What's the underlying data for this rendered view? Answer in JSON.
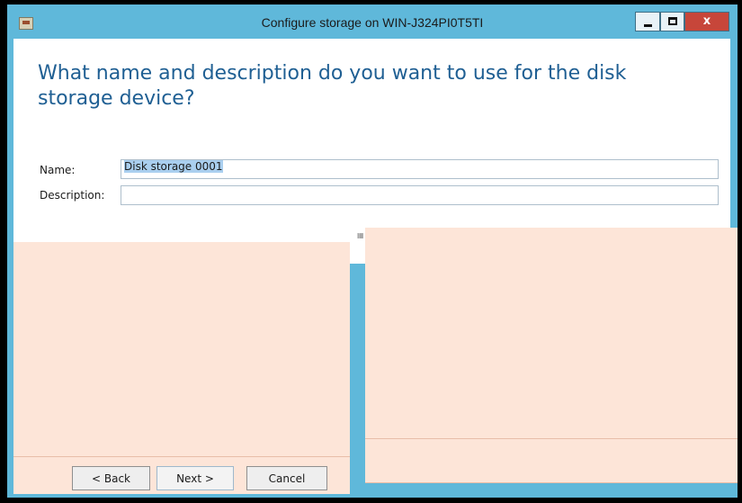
{
  "window": {
    "title": "Configure storage on WIN-J324PI0T5TI",
    "close_glyph": "x"
  },
  "page": {
    "heading": "What name and description do you want to use for the disk storage device?"
  },
  "form": {
    "name_label": "Name:",
    "name_value": "Disk storage 0001",
    "description_label": "Description:",
    "description_value": ""
  },
  "footer": {
    "back_label": "< Back",
    "next_label": "Next >",
    "cancel_label": "Cancel"
  },
  "icons": {
    "app": "storage-app-icon",
    "minimize": "minimize-icon",
    "maximize": "maximize-icon",
    "close": "close-icon"
  },
  "colors": {
    "titlebar": "#5fb8da",
    "heading": "#1f5f93",
    "overlay": "#fde5d8",
    "selection": "#aacfef",
    "close_button": "#c7463a"
  }
}
